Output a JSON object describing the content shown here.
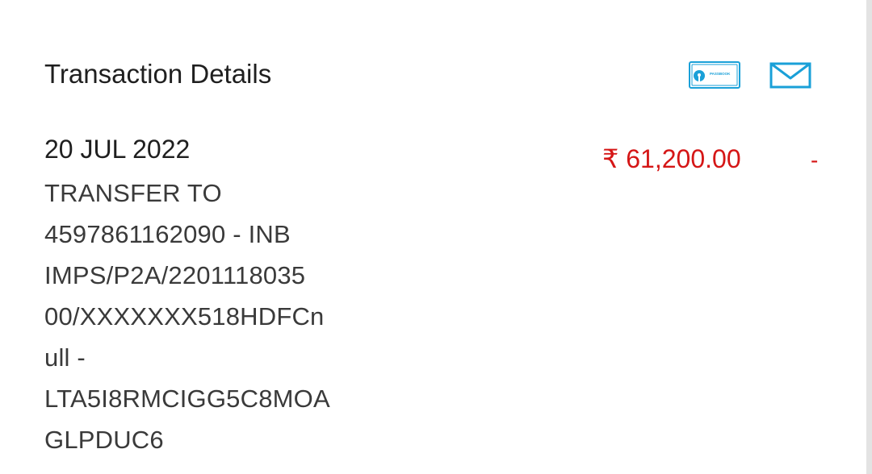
{
  "header": {
    "title": "Transaction Details",
    "passbook_icon": "passbook-icon",
    "passbook_icon_text": "PASSBOOK",
    "mail_icon": "envelope-icon"
  },
  "transaction": {
    "date": "20 JUL 2022",
    "amount": "₹ 61,200.00",
    "amount_suffix": "-",
    "description_lines": [
      "TRANSFER TO",
      "4597861162090 - INB",
      "IMPS/P2A/2201118035",
      "00/XXXXXXX518HDFCn",
      "ull -",
      "LTA5I8RMCIGG5C8MOA",
      "GLPDUC6"
    ]
  },
  "colors": {
    "accent": "#1aa0d8",
    "debit": "#d51616",
    "text": "#1f1f1f"
  }
}
